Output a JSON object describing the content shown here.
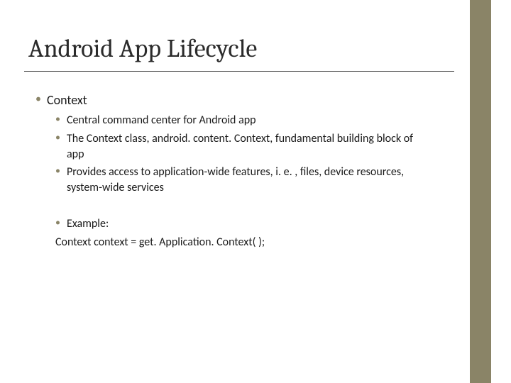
{
  "title": "Android App Lifecycle",
  "bullet_lvl1": "Context",
  "group1": {
    "b1": "Central command center for Android app",
    "b2": "The Context class, android. content. Context, fundamental building block of app",
    "b3": "Provides access to application-wide features, i. e. , files, device resources, system-wide services"
  },
  "group2": {
    "b1": "Example:",
    "code": "Context context = get. Application. Context( );"
  }
}
